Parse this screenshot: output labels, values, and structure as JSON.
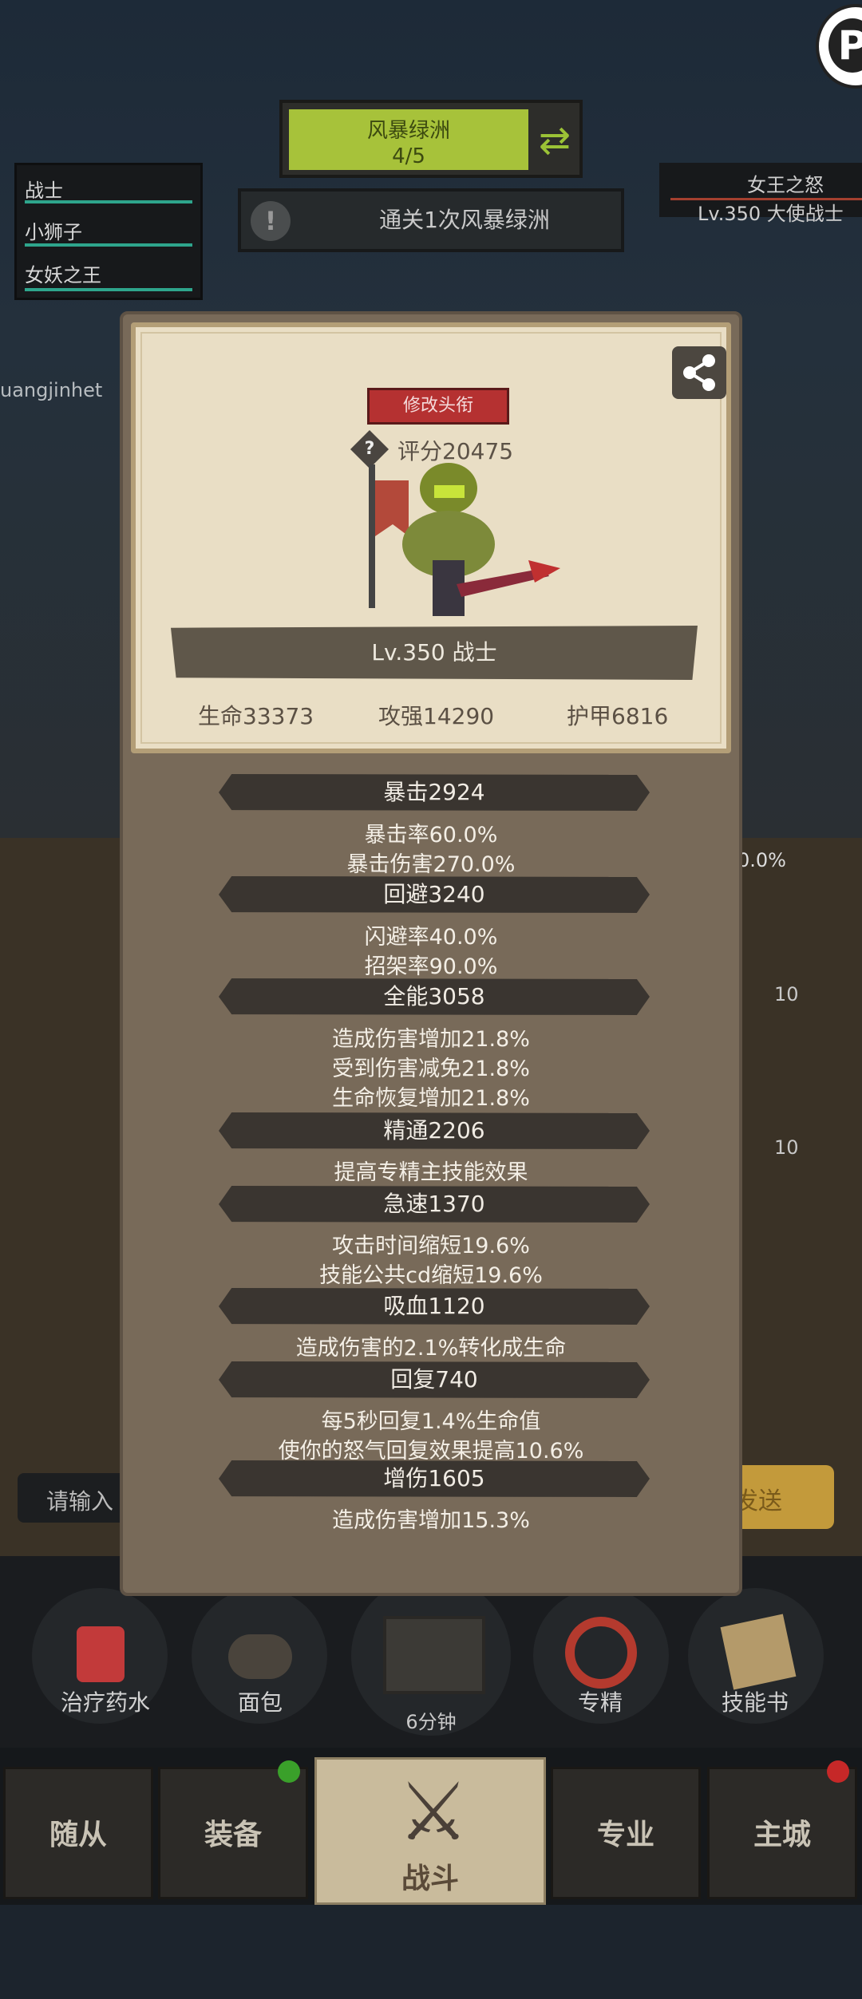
{
  "top": {
    "stage_name": "风暴绿洲",
    "stage_progress": "4/5",
    "quest": "通关1次风暴绿洲",
    "party": [
      "战士",
      "小狮子",
      "女妖之王"
    ],
    "enemy_name": "女王之怒",
    "enemy_level": "Lv.350 大使战士",
    "player_id": "uangjinhet",
    "side_percent": "0.0%",
    "slot_counts": [
      "10",
      "10"
    ],
    "chat_placeholder": "请输入",
    "send_label": "发送"
  },
  "popup": {
    "title_button": "修改头衔",
    "score": "评分20475",
    "level_label": "Lv.350 战士",
    "stats": {
      "hp": "生命33373",
      "attack": "攻强14290",
      "armor": "护甲6816"
    },
    "sections": [
      {
        "header": "暴击2924",
        "lines": [
          "暴击率60.0%",
          "暴击伤害270.0%"
        ]
      },
      {
        "header": "回避3240",
        "lines": [
          "闪避率40.0%",
          "招架率90.0%"
        ]
      },
      {
        "header": "全能3058",
        "lines": [
          "造成伤害增加21.8%",
          "受到伤害减免21.8%",
          "生命恢复增加21.8%"
        ]
      },
      {
        "header": "精通2206",
        "lines": [
          "提高专精主技能效果"
        ]
      },
      {
        "header": "急速1370",
        "lines": [
          "攻击时间缩短19.6%",
          "技能公共cd缩短19.6%"
        ]
      },
      {
        "header": "吸血1120",
        "lines": [
          "造成伤害的2.1%转化成生命"
        ]
      },
      {
        "header": "回复740",
        "lines": [
          "每5秒回复1.4%生命值",
          "使你的怒气回复效果提高10.6%"
        ]
      },
      {
        "header": "增伤1605",
        "lines": [
          "造成伤害增加15.3%"
        ]
      }
    ]
  },
  "skills": {
    "items": [
      "治疗药水",
      "面包",
      "专精",
      "技能书"
    ],
    "chest_timer": "6分钟"
  },
  "nav": {
    "tabs": [
      "随从",
      "装备",
      "战斗",
      "专业",
      "主城"
    ]
  },
  "colors": {
    "stage_green": "#a7c23a",
    "title_red": "#b53131",
    "badge_green": "#3aa02a",
    "badge_red": "#c62828"
  }
}
